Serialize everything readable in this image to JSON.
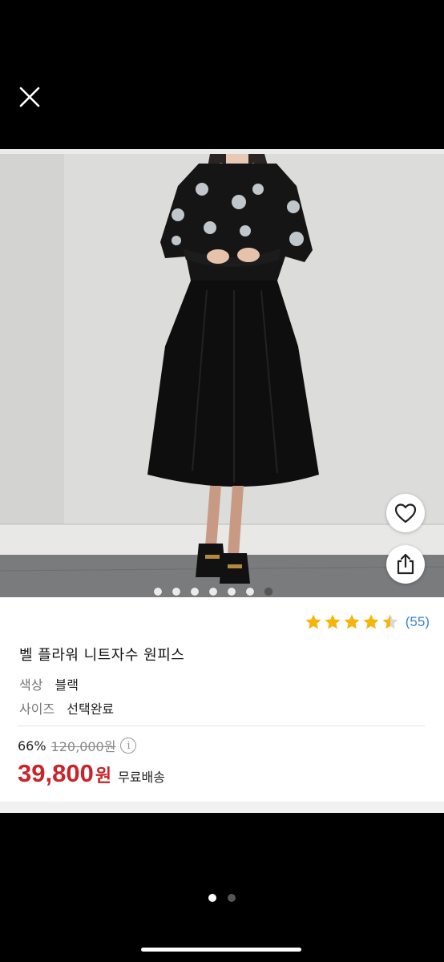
{
  "product": {
    "title": "벨 플라워 니트자수 원피스",
    "rating": 4.5,
    "rating_count": "(55)",
    "options": [
      {
        "key": "색상",
        "value": "블랙"
      },
      {
        "key": "사이즈",
        "value": "선택완료"
      }
    ],
    "discount_percent": "66%",
    "original_price": "120,000원",
    "sale_price": "39,800",
    "currency": "원",
    "shipping": "무료배송"
  },
  "gallery": {
    "image_count": 7,
    "active_index": 6
  },
  "pager": {
    "page_count": 2,
    "active_index": 0
  },
  "icons": {
    "close": "close-icon",
    "heart": "heart-icon",
    "share": "share-icon",
    "info": "info-icon",
    "star": "star-icon"
  },
  "colors": {
    "price": "#c8252b",
    "star": "#f5b50a",
    "rating_count": "#3b82d6"
  }
}
